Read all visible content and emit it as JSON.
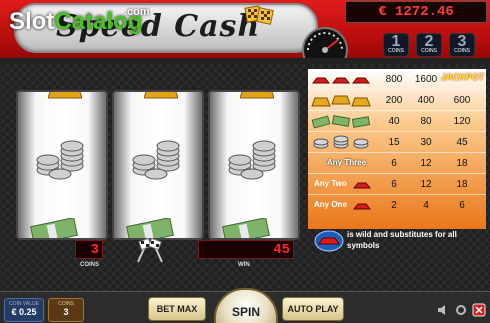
{
  "header": {
    "game_title": "Speed Cash",
    "watermark_part1": "Slot",
    "watermark_part2": "Catalog",
    "watermark_suffix": ".com",
    "balance": "€ 1272.46",
    "coin_options": [
      {
        "number": "1",
        "label": "COINS"
      },
      {
        "number": "2",
        "label": "COINS"
      },
      {
        "number": "3",
        "label": "COINS"
      }
    ]
  },
  "reels": [
    {
      "symbols": [
        "gold-bar-icon",
        "silver-coins-icon",
        "cash-bundle-icon"
      ]
    },
    {
      "symbols": [
        "gold-bar-icon",
        "silver-coins-icon",
        "cash-bundle-icon"
      ]
    },
    {
      "symbols": [
        "gold-bar-icon",
        "silver-coins-icon",
        "cash-bundle-icon"
      ]
    }
  ],
  "paytable": {
    "jackpot_label": "JACKPOT",
    "rows": [
      {
        "symbol": "red-cars-icon",
        "label": "",
        "values": [
          "800",
          "1600",
          ""
        ]
      },
      {
        "symbol": "gold-bars-icon",
        "label": "",
        "values": [
          "200",
          "400",
          "600"
        ]
      },
      {
        "symbol": "cash-bundles-icon",
        "label": "",
        "values": [
          "40",
          "80",
          "120"
        ]
      },
      {
        "symbol": "silver-coins-icon",
        "label": "",
        "values": [
          "15",
          "30",
          "45"
        ]
      },
      {
        "symbol": "any-three-icon",
        "label": "Any Three",
        "values": [
          "6",
          "12",
          "18"
        ]
      },
      {
        "symbol": "any-two-icon",
        "label": "Any Two",
        "values": [
          "6",
          "12",
          "18"
        ]
      },
      {
        "symbol": "any-one-icon",
        "label": "Any One",
        "values": [
          "2",
          "4",
          "6"
        ]
      }
    ],
    "wild_text": "is wild and substitutes for all symbols"
  },
  "counters": {
    "coins_value": "3",
    "coins_label": "COINS",
    "win_value": "45",
    "win_label": "WIN"
  },
  "bottom": {
    "coin_value_label": "COIN VALUE",
    "coin_value": "€ 0.25",
    "coins_label": "COINS",
    "coins_value": "3",
    "bet_max": "BET MAX",
    "spin": "SPIN",
    "auto_play": "AUTO PLAY"
  },
  "colors": {
    "header_red": "#d01414",
    "paytable_orange": "#f08a1c",
    "led_red": "#ff2626",
    "jackpot_yellow": "#ffe82a"
  }
}
